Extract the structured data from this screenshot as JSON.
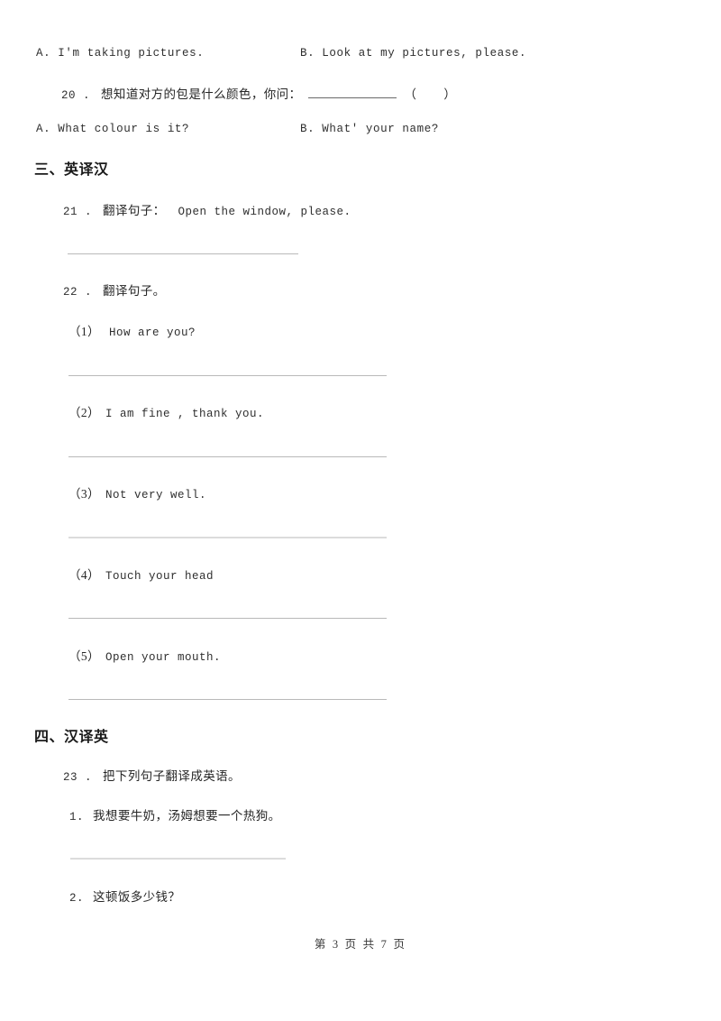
{
  "document": {
    "page_label": "第 3 页 共 7 页",
    "page_number": "3",
    "total_pages": "7"
  },
  "carryover": {
    "q19_options": {
      "option_a": "A. I'm taking pictures.",
      "option_b": "B. Look at my pictures, please."
    },
    "q20": {
      "number": "20 .",
      "stem": "想知道对方的包是什么颜色，你问：",
      "bracket_open": "（",
      "bracket_close": "）",
      "option_a": "A. What colour is it?",
      "option_b": "B. What' your name?"
    }
  },
  "sections": [
    {
      "id": "section-3",
      "heading": "三、英译汉",
      "questions": [
        {
          "number": "21 .",
          "prompt_cn": "翻译句子：",
          "prompt_en": "Open the window, please.",
          "sub_items": []
        },
        {
          "number": "22 .",
          "prompt_cn": "翻译句子。",
          "prompt_en": "",
          "sub_items": [
            {
              "label": "（1）",
              "text": "How are you?"
            },
            {
              "label": "（2）",
              "text": "I am fine , thank you."
            },
            {
              "label": "（3）",
              "text": "Not very well."
            },
            {
              "label": "（4）",
              "text": "Touch your head"
            },
            {
              "label": "（5）",
              "text": "Open your mouth."
            }
          ]
        }
      ]
    },
    {
      "id": "section-4",
      "heading": "四、汉译英",
      "questions": [
        {
          "number": "23 .",
          "prompt_cn": "把下列句子翻译成英语。",
          "prompt_en": "",
          "sub_items": [
            {
              "label": "1.",
              "text": "我想要牛奶，汤姆想要一个热狗。"
            },
            {
              "label": "2.",
              "text": "这顿饭多少钱？"
            }
          ]
        }
      ]
    }
  ],
  "colors": {
    "page_background": "#ffffff",
    "body_text": "#2b2b2b",
    "heading_text": "#1a1a1a",
    "rule_line": "#b9b9b9",
    "rule_line_light": "#dcdcdc"
  }
}
